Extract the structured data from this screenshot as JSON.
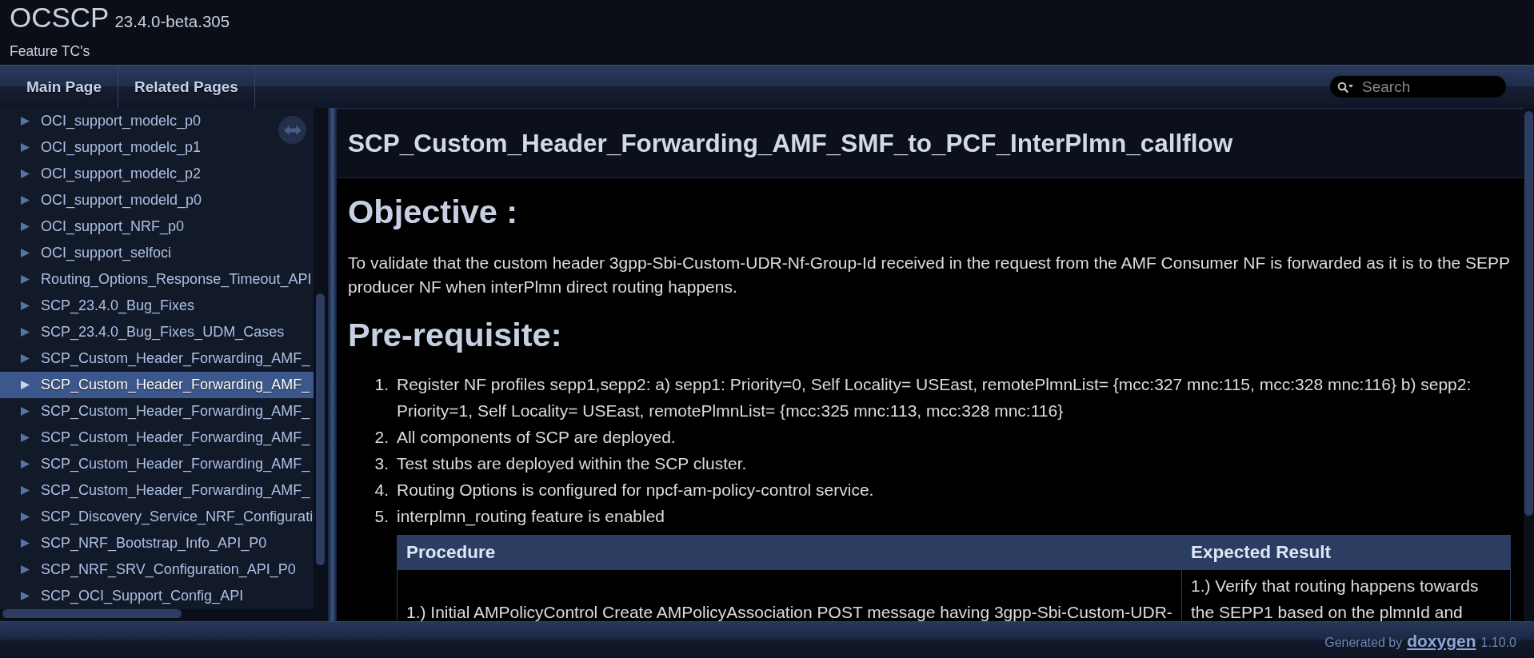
{
  "header": {
    "title": "OCSCP",
    "version": "23.4.0-beta.305",
    "brief": "Feature TC's"
  },
  "navbar": {
    "tabs": [
      "Main Page",
      "Related Pages"
    ],
    "search": {
      "placeholder": "Search"
    }
  },
  "sidebar": {
    "items": [
      {
        "label": "OCI_support_modelc_p0",
        "expanded": false,
        "selected": false
      },
      {
        "label": "OCI_support_modelc_p1",
        "expanded": false,
        "selected": false
      },
      {
        "label": "OCI_support_modelc_p2",
        "expanded": false,
        "selected": false
      },
      {
        "label": "OCI_support_modeld_p0",
        "expanded": false,
        "selected": false
      },
      {
        "label": "OCI_support_NRF_p0",
        "expanded": false,
        "selected": false
      },
      {
        "label": "OCI_support_selfoci",
        "expanded": false,
        "selected": false
      },
      {
        "label": "Routing_Options_Response_Timeout_API",
        "expanded": false,
        "selected": false
      },
      {
        "label": "SCP_23.4.0_Bug_Fixes",
        "expanded": false,
        "selected": false
      },
      {
        "label": "SCP_23.4.0_Bug_Fixes_UDM_Cases",
        "expanded": false,
        "selected": false
      },
      {
        "label": "SCP_Custom_Header_Forwarding_AMF_",
        "expanded": false,
        "selected": false
      },
      {
        "label": "SCP_Custom_Header_Forwarding_AMF_",
        "expanded": false,
        "selected": true
      },
      {
        "label": "SCP_Custom_Header_Forwarding_AMF_",
        "expanded": false,
        "selected": false
      },
      {
        "label": "SCP_Custom_Header_Forwarding_AMF_",
        "expanded": false,
        "selected": false
      },
      {
        "label": "SCP_Custom_Header_Forwarding_AMF_",
        "expanded": false,
        "selected": false
      },
      {
        "label": "SCP_Custom_Header_Forwarding_AMF_",
        "expanded": false,
        "selected": false
      },
      {
        "label": "SCP_Discovery_Service_NRF_Configurati",
        "expanded": false,
        "selected": false
      },
      {
        "label": "SCP_NRF_Bootstrap_Info_API_P0",
        "expanded": false,
        "selected": false
      },
      {
        "label": "SCP_NRF_SRV_Configuration_API_P0",
        "expanded": false,
        "selected": false
      },
      {
        "label": "SCP_OCI_Support_Config_API",
        "expanded": false,
        "selected": false
      }
    ]
  },
  "content": {
    "title": "SCP_Custom_Header_Forwarding_AMF_SMF_to_PCF_InterPlmn_callflow",
    "sections": [
      {
        "kind": "paragraph",
        "heading": "Objective :",
        "text": "To validate that the custom header 3gpp-Sbi-Custom-UDR-Nf-Group-Id received in the request from the AMF Consumer NF is forwarded as it is to the SEPP producer NF when interPlmn direct routing happens."
      },
      {
        "kind": "list",
        "heading": "Pre-requisite:",
        "items": [
          {
            "number": "1.",
            "text": "Register NF profiles sepp1,sepp2: a) sepp1: Priority=0, Self Locality= USEast, remotePlmnList= {mcc:327 mnc:115, mcc:328 mnc:116} b) sepp2: Priority=1, Self Locality= USEast, remotePlmnList= {mcc:325 mnc:113, mcc:328 mnc:116}"
          },
          {
            "number": "2.",
            "text": "All components of SCP are deployed."
          },
          {
            "number": "3.",
            "text": "Test stubs are deployed within the SCP cluster."
          },
          {
            "number": "4.",
            "text": "Routing Options is configured for npcf-am-policy-control service."
          },
          {
            "number": "5.",
            "text": "interplmn_routing feature is enabled"
          }
        ]
      }
    ],
    "table": {
      "columns": [
        "Procedure",
        "Expected Result"
      ],
      "rows": [
        [
          "1.) Initial AMPolicyControl Create AMPolicyAssociation POST message having 3gpp-Sbi-Custom-UDR-",
          "1.) Verify that routing happens towards the SEPP1 based on the plmnId and"
        ]
      ]
    }
  },
  "footer": {
    "generated_by": "Generated by",
    "link": "doxygen",
    "version": "1.10.0"
  }
}
